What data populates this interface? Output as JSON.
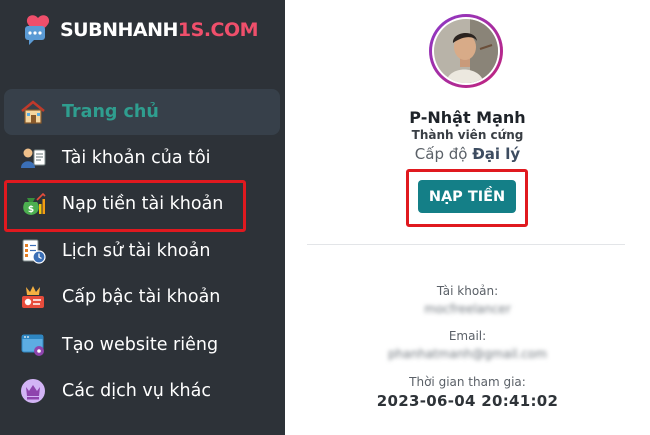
{
  "brand": {
    "name_part1": "SUBNHANH",
    "name_part2": "1S",
    "name_part3": ".COM"
  },
  "sidebar": {
    "items": [
      {
        "label": "Trang chủ",
        "active": true
      },
      {
        "label": "Tài khoản của tôi",
        "active": false
      },
      {
        "label": "Nạp tiền tài khoản",
        "active": false,
        "highlighted": true
      },
      {
        "label": "Lịch sử tài khoản",
        "active": false
      },
      {
        "label": "Cấp bậc tài khoản",
        "active": false
      },
      {
        "label": "Tạo website riêng",
        "active": false
      },
      {
        "label": "Các dịch vụ khác",
        "active": false
      }
    ]
  },
  "profile": {
    "name": "P-Nhật Mạnh",
    "role": "Thành viên cứng",
    "level_prefix": "Cấp độ",
    "level_value": "Đại lý",
    "topup_button": "NẠP TIỀN"
  },
  "account_info": {
    "username_label": "Tài khoản:",
    "username_value": "mocfreelancer",
    "email_label": "Email:",
    "email_value": "phanhatmanh@gmail.com",
    "joined_label": "Thời gian tham gia:",
    "joined_value": "2023-06-04 20:41:02"
  },
  "colors": {
    "sidebar_bg": "#2d3238",
    "active_text": "#2f9e8f",
    "button_bg": "#147f87",
    "highlight_border": "#e0191f",
    "brand_accent": "#ef4f6b"
  }
}
